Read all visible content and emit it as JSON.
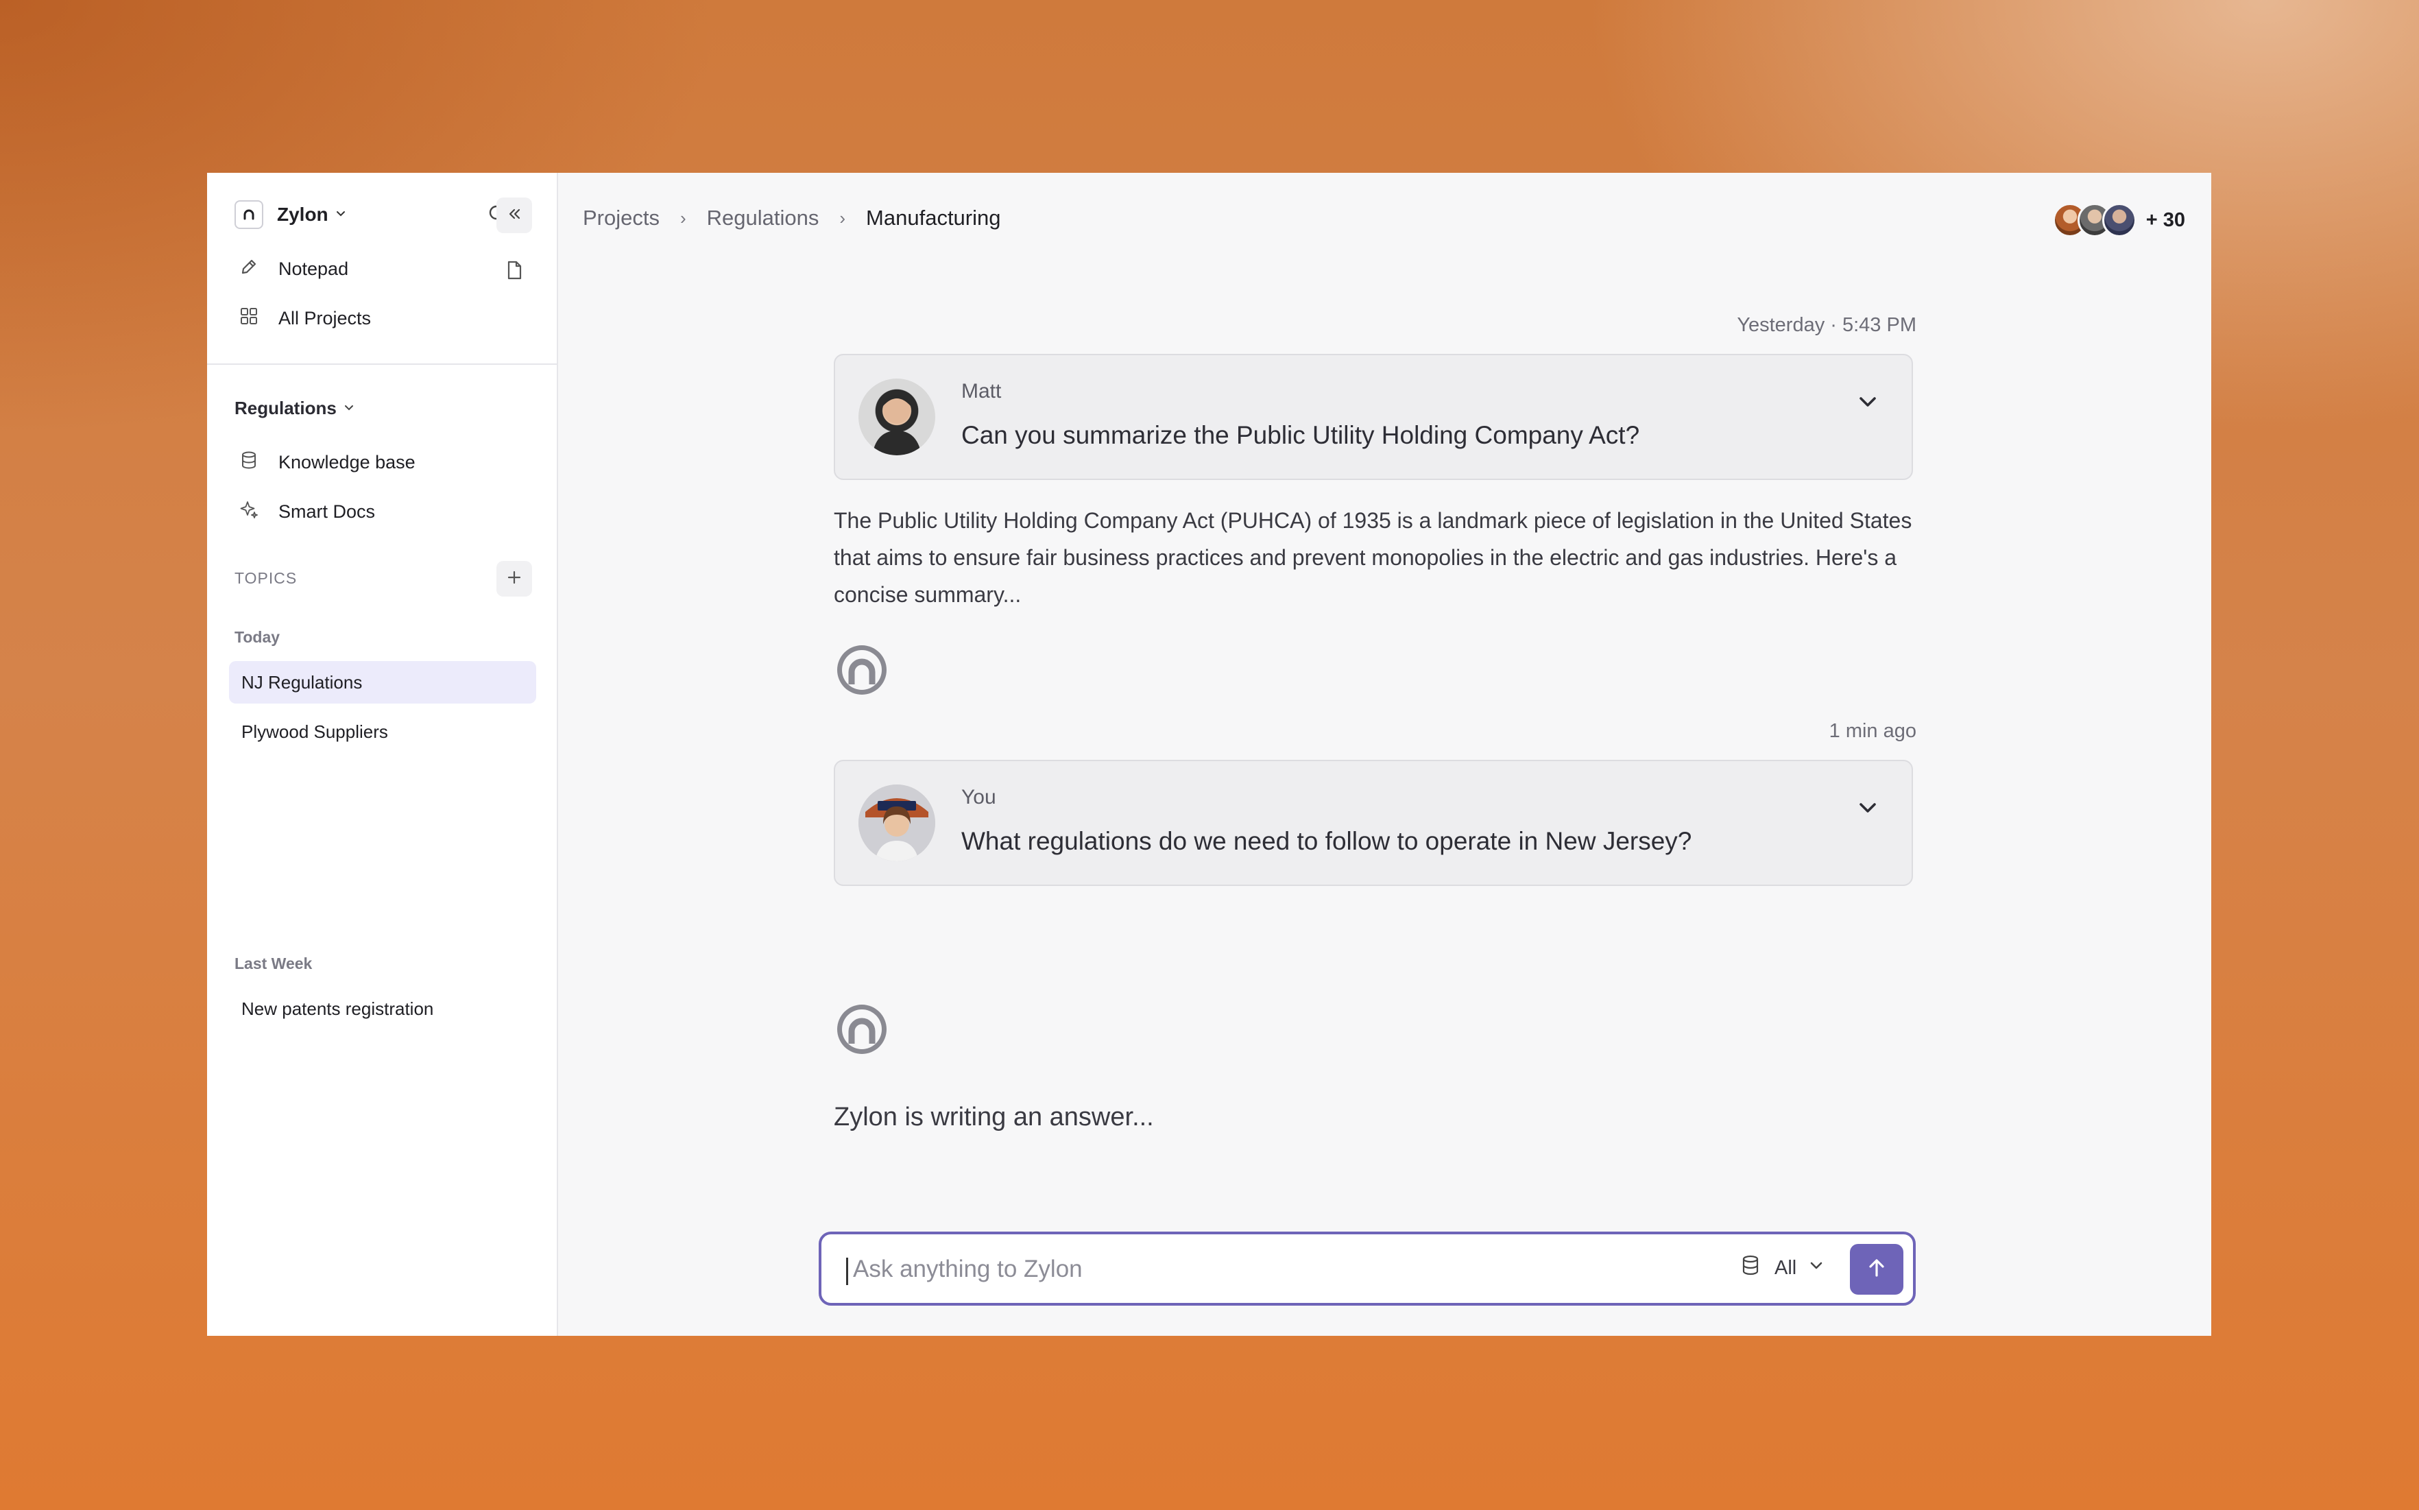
{
  "sidebar": {
    "brand": "Zylon",
    "nav": [
      {
        "label": "Notepad",
        "icon": "pencil-icon"
      },
      {
        "label": "All Projects",
        "icon": "grid-icon"
      }
    ],
    "workspace": "Regulations",
    "workspace_nav": [
      {
        "label": "Knowledge base",
        "icon": "database-icon"
      },
      {
        "label": "Smart Docs",
        "icon": "sparkle-icon"
      }
    ],
    "topics_label": "TOPICS",
    "groups": [
      {
        "label": "Today",
        "items": [
          "NJ Regulations",
          "Plywood Suppliers"
        ]
      },
      {
        "label": "Last Week",
        "items": [
          "New patents registration"
        ]
      }
    ],
    "active_topic": "NJ Regulations"
  },
  "breadcrumb": [
    "Projects",
    "Regulations",
    "Manufacturing"
  ],
  "collaborators": {
    "extra_count": "+ 30"
  },
  "messages": [
    {
      "timestamp": "Yesterday · 5:43 PM",
      "author": "Matt",
      "text": "Can you summarize the Public Utility Holding Company Act?",
      "answer": "The Public Utility Holding Company Act (PUHCA) of 1935 is a landmark piece of legislation in the United States that aims to ensure fair business practices and prevent monopolies in the electric and gas industries. Here's a concise summary..."
    },
    {
      "timestamp": "1 min ago",
      "author": "You",
      "text": "What regulations do we need to follow to operate in New Jersey?",
      "answer": "Zylon is writing an answer..."
    }
  ],
  "composer": {
    "placeholder": "Ask anything to Zylon",
    "source": "All"
  },
  "colors": {
    "accent": "#6e64b8",
    "active_topic_bg": "#ecebfb"
  }
}
